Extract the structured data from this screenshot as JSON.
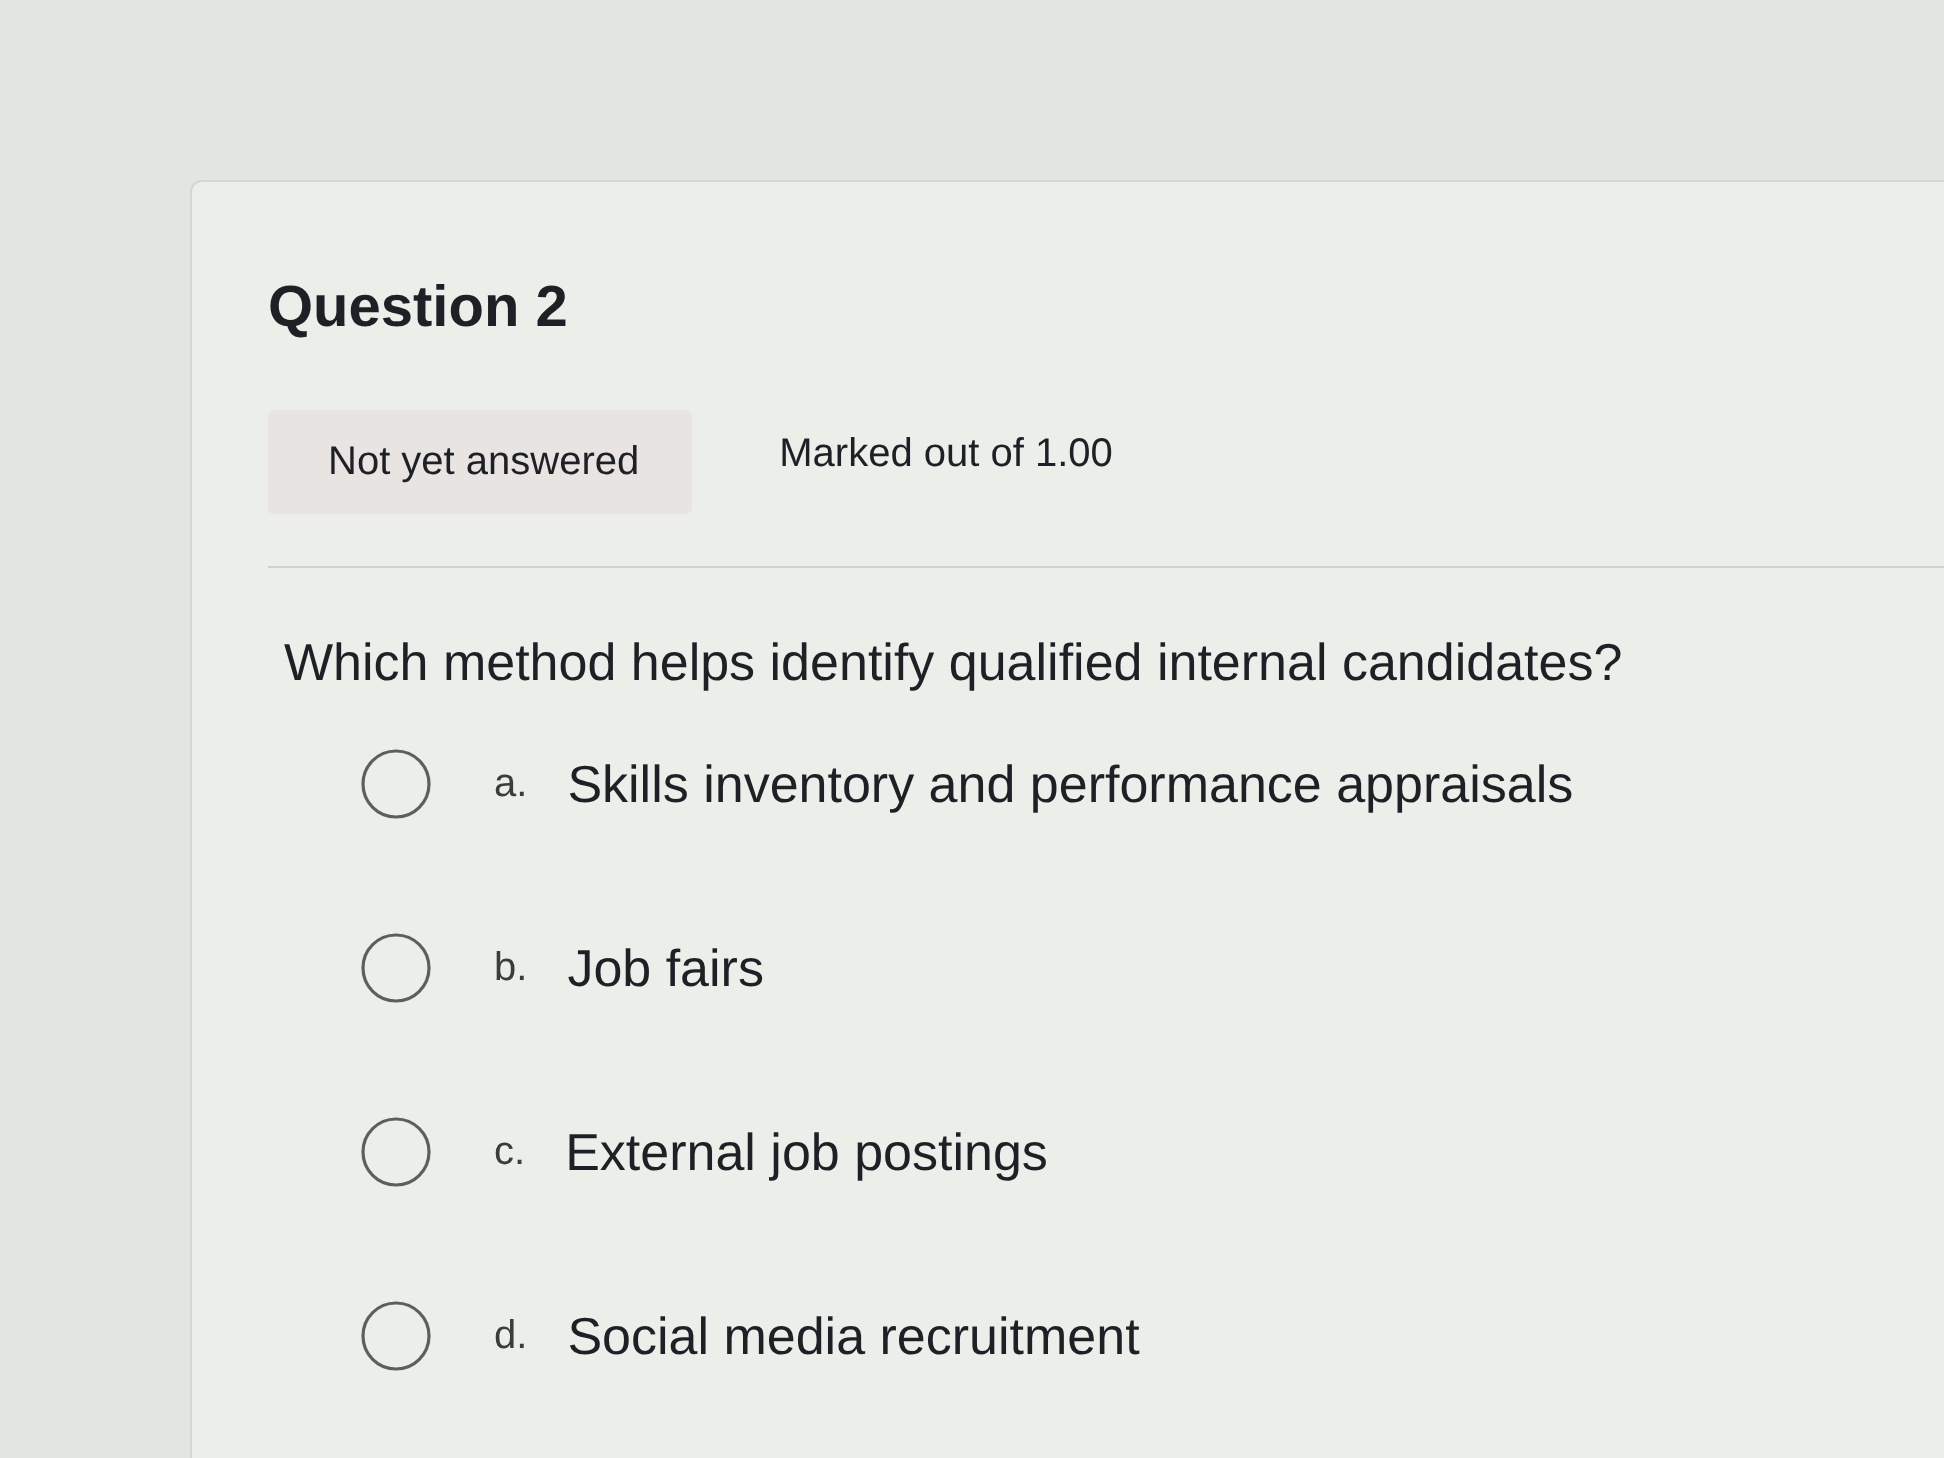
{
  "question": {
    "title": "Question 2",
    "status": "Not yet answered",
    "mark": "Marked out of 1.00",
    "text": "Which method helps identify qualified internal candidates?"
  },
  "options": [
    {
      "letter": "a.",
      "label": "Skills inventory and performance appraisals",
      "selected": false
    },
    {
      "letter": "b.",
      "label": "Job fairs",
      "selected": false
    },
    {
      "letter": "c.",
      "label": "External job postings",
      "selected": false
    },
    {
      "letter": "d.",
      "label": "Social media recruitment",
      "selected": false
    }
  ]
}
